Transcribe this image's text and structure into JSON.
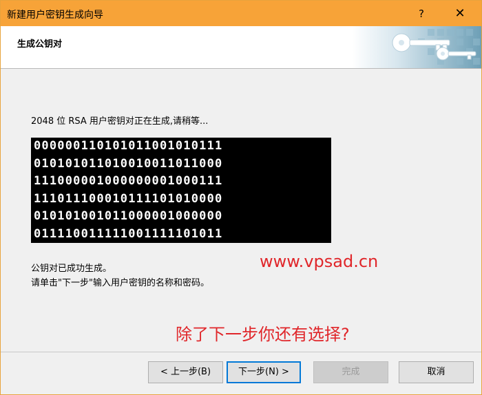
{
  "window": {
    "title": "新建用户密钥生成向导",
    "help_label": "?",
    "close_label": "✕"
  },
  "header": {
    "heading": "生成公钥对"
  },
  "content": {
    "status": "2048 位 RSA 用户密钥对正在生成,请稍等...",
    "binary_lines": [
      "000000110101011001010111",
      "010101011010010011011000",
      "111000001000000001000111",
      "111011100010111101010000",
      "010101001011000001000000",
      "011110011111001111101011"
    ],
    "done_line1": "公钥对已成功生成。",
    "done_line2": "请单击\"下一步\"输入用户密钥的名称和密码。",
    "watermark": "www.vpsad.cn",
    "question": "除了下一步你还有选择?"
  },
  "buttons": {
    "back": "< 上一步(B)",
    "next": "下一步(N) >",
    "finish": "完成",
    "cancel": "取消"
  },
  "colors": {
    "titlebar": "#f7a338",
    "annotation": "#e0262a",
    "focus_border": "#0078d7"
  }
}
